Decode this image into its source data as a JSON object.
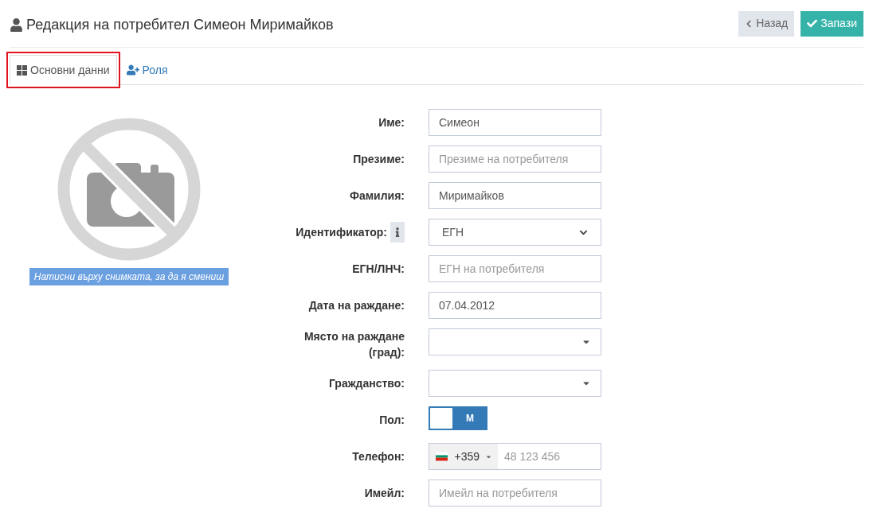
{
  "header": {
    "title": "Редакция на потребител Симеон Миримайков",
    "buttons": [
      {
        "kind": "back",
        "label": "Назад"
      },
      {
        "kind": "save",
        "label": "Запази"
      }
    ]
  },
  "tabs": [
    {
      "kind": "grid",
      "label": "Основни данни",
      "selected": true,
      "highlighted": true
    },
    {
      "kind": "user-plus",
      "label": "Роля",
      "selected": false,
      "highlighted": false
    }
  ],
  "photo": {
    "caption": "Натисни върху снимката, за да я смениш"
  },
  "fields": [
    {
      "kind": "text",
      "label": "Име:",
      "value": "Симеон"
    },
    {
      "kind": "text",
      "label": "Презиме:",
      "placeholder": "Презиме на потребителя"
    },
    {
      "kind": "text",
      "label": "Фамилия:",
      "value": "Миримайков"
    },
    {
      "kind": "select",
      "label": "Идентификатор:",
      "info": true,
      "value": "ЕГН"
    },
    {
      "kind": "text",
      "label": "ЕГН/ЛНЧ:",
      "placeholder": "ЕГН на потребителя"
    },
    {
      "kind": "text",
      "label": "Дата на раждане:",
      "value": "07.04.2012"
    },
    {
      "kind": "combo",
      "label": "Място на раждане (град):"
    },
    {
      "kind": "combo",
      "label": "Гражданство:"
    },
    {
      "kind": "toggle",
      "label": "Пол:",
      "value": "М",
      "on": false
    },
    {
      "kind": "phone",
      "label": "Телефон:",
      "code": "+359",
      "placeholder": "48 123 456"
    },
    {
      "kind": "text",
      "label": "Имейл:",
      "placeholder": "Имейл на потребителя"
    }
  ]
}
